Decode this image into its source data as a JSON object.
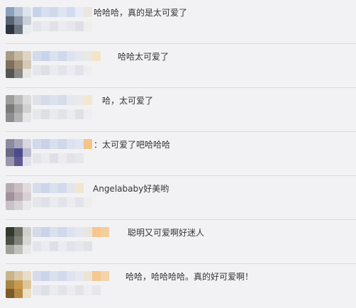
{
  "comments": [
    {
      "text": "哈哈哈，真的是太可爱了"
    },
    {
      "text": "哈哈太可爱了"
    },
    {
      "text": "哈，太可爱了"
    },
    {
      "text": "：太可爱了吧哈哈哈"
    },
    {
      "text": "Angelababy好美哟"
    },
    {
      "text": "聪明又可爱啊好迷人"
    },
    {
      "text": "哈哈，哈哈哈哈。真的好可爱啊！"
    }
  ]
}
